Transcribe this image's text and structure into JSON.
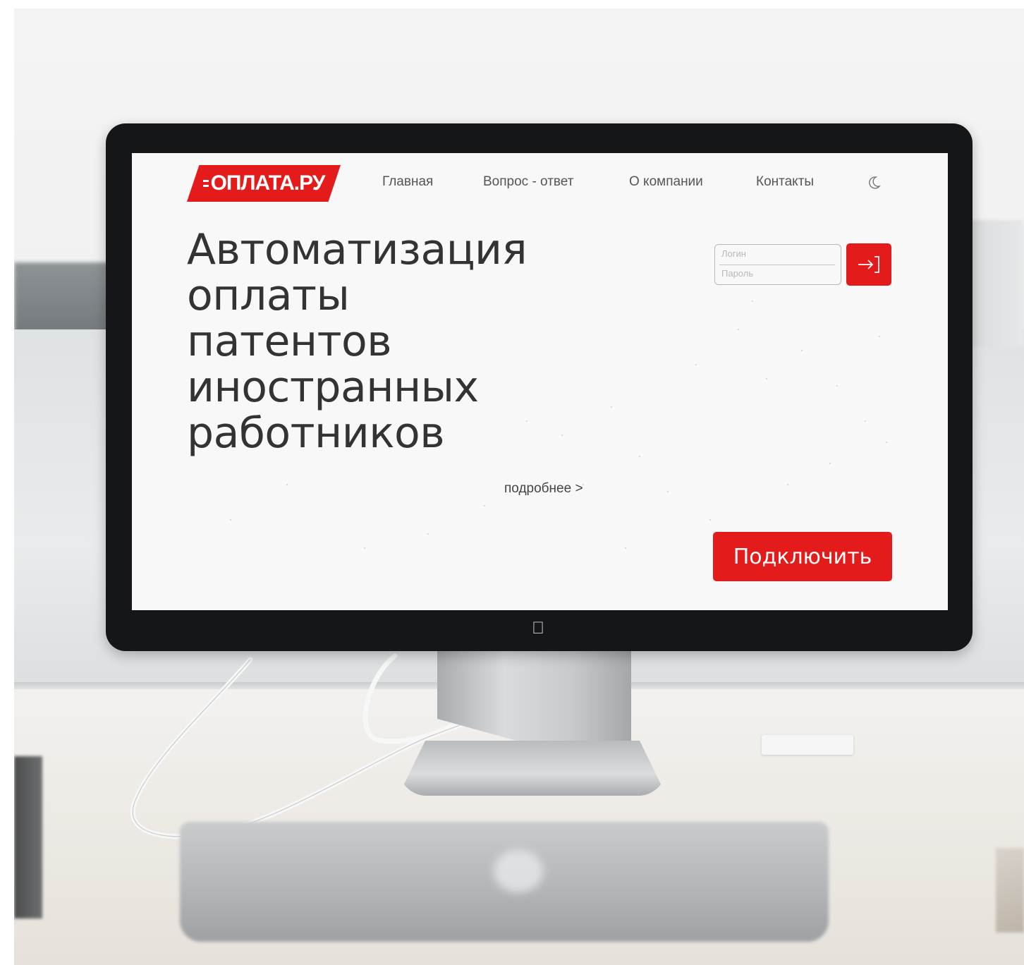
{
  "site": {
    "logo_text": "ОПЛАТА.РУ",
    "brand_color": "#e31b1b",
    "nav": {
      "home": "Главная",
      "faq": "Вопрос - ответ",
      "about": "О компании",
      "contacts": "Контакты"
    },
    "theme_toggle_icon": "moon-icon",
    "headline": [
      "Автоматизация",
      "оплаты",
      "патентов",
      "иностранных",
      "работников"
    ],
    "more_link": "подробнее >",
    "login": {
      "login_placeholder": "Логин",
      "password_placeholder": "Пароль",
      "submit_icon": "login-arrow-icon"
    },
    "connect_button": "Подключить"
  }
}
